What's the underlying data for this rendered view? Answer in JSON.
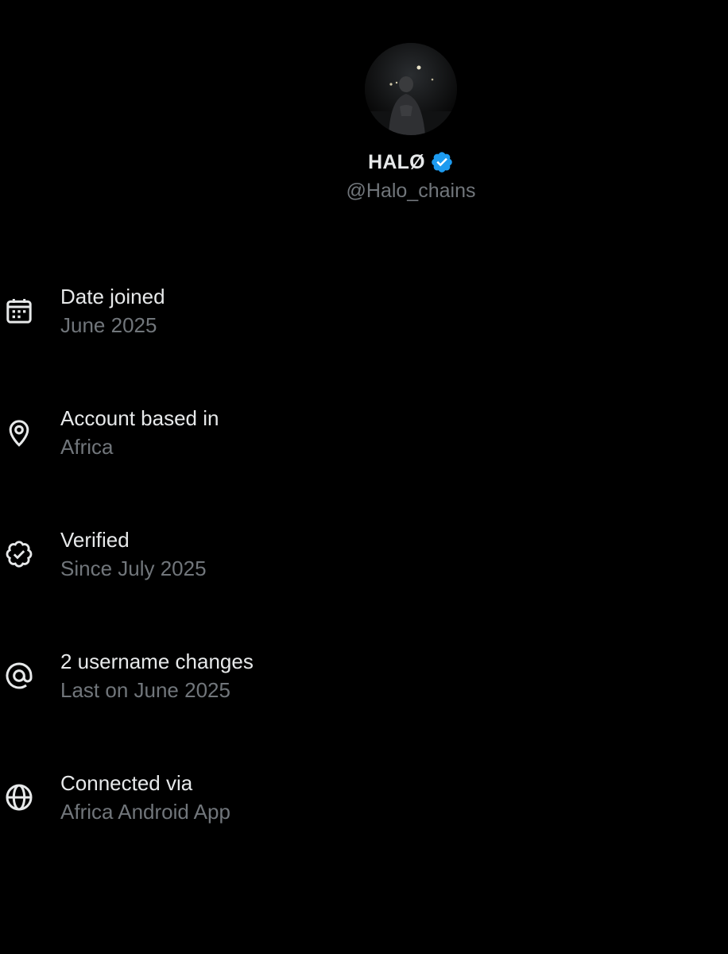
{
  "profile": {
    "display_name": "HALØ",
    "handle": "@Halo_chains",
    "verified_badge_icon": "verified-badge-icon",
    "badge_color": "#1d9bf0"
  },
  "about_items": [
    {
      "icon": "calendar-icon",
      "title": "Date joined",
      "value": "June 2025"
    },
    {
      "icon": "location-pin-icon",
      "title": "Account based in",
      "value": "Africa"
    },
    {
      "icon": "verified-check-icon",
      "title": "Verified",
      "value": "Since July 2025"
    },
    {
      "icon": "at-sign-icon",
      "title": "2 username changes",
      "value": "Last on June 2025"
    },
    {
      "icon": "globe-icon",
      "title": "Connected via",
      "value": "Africa Android App"
    }
  ],
  "colors": {
    "background": "#000000",
    "primary_text": "#e7e9ea",
    "secondary_text": "#71767b",
    "accent": "#1d9bf0"
  }
}
